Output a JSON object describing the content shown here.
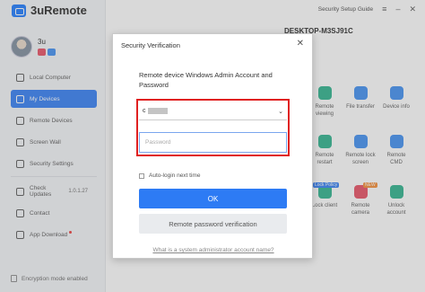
{
  "app": {
    "name": "3uRemote"
  },
  "user": {
    "name": "3u"
  },
  "nav": {
    "items": [
      {
        "label": "Local Computer"
      },
      {
        "label": "My Devices"
      },
      {
        "label": "Remote Devices"
      },
      {
        "label": "Screen Wall"
      },
      {
        "label": "Security Settings"
      }
    ],
    "bottom": [
      {
        "label": "Check Updates",
        "version": "1.0.1.27"
      },
      {
        "label": "Contact"
      },
      {
        "label": "App Download"
      }
    ]
  },
  "footer": {
    "encryption": "Encryption mode enabled"
  },
  "topbar": {
    "guide": "Security Setup Guide"
  },
  "device": {
    "name": "DESKTOP-M3SJ91C"
  },
  "tiles": [
    {
      "label": "Remote viewing",
      "color": "#27b08a"
    },
    {
      "label": "File transfer",
      "color": "#3b8cf2"
    },
    {
      "label": "Device info",
      "color": "#3b8cf2"
    },
    {
      "label": "Remote restart",
      "color": "#27b08a"
    },
    {
      "label": "Remote lock screen",
      "color": "#3b8cf2"
    },
    {
      "label": "Remote CMD",
      "color": "#3b8cf2"
    },
    {
      "label": "Lock client",
      "color": "#27b08a",
      "badge": "Lock Policy"
    },
    {
      "label": "Remote camera",
      "color": "#e84a5f",
      "badge": "NEW"
    },
    {
      "label": "Unlock account",
      "color": "#27b08a"
    }
  ],
  "dialog": {
    "title": "Security Verification",
    "message": "Remote device Windows Admin Account and Password",
    "account_prefix": "c",
    "password_placeholder": "Password",
    "auto_login": "Auto-login next time",
    "ok": "OK",
    "remote_verify": "Remote password verification",
    "help_link": "What is a system administrator account name?"
  },
  "colors": {
    "accent": "#2d7bf4",
    "highlight": "#e02020"
  }
}
